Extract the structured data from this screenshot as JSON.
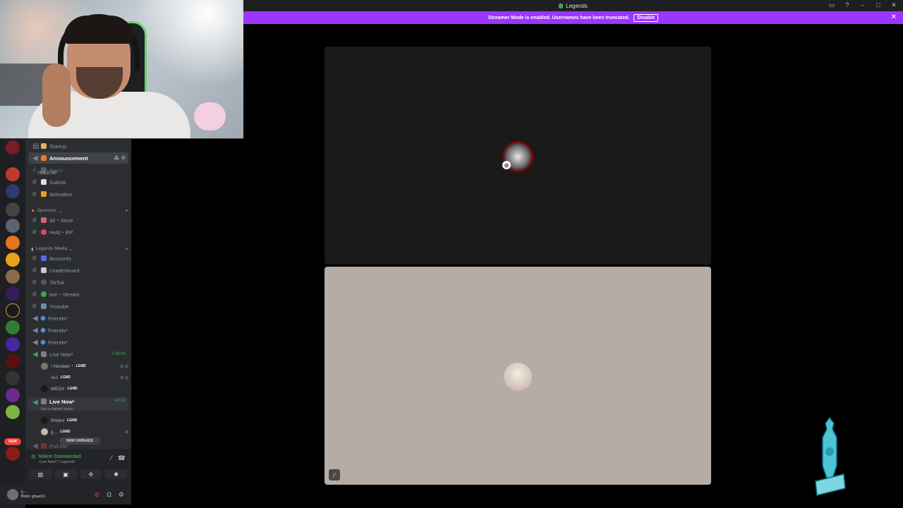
{
  "window": {
    "title": "Legends",
    "controls": [
      "inbox-icon",
      "help-icon",
      "minimize-icon",
      "maximize-icon",
      "close-icon"
    ]
  },
  "banner": {
    "text": "Streamer Mode is enabled. Usernames have been truncated.",
    "disable_label": "Disable",
    "close_symbol": "✕"
  },
  "channels": {
    "startup": "Startup",
    "announcement": "Announcement",
    "boost": "Boost",
    "hold_rp_overlay": "HOLD RP",
    "submit": "Submit",
    "activation": "Activation",
    "sponsors_category": "Sponsors",
    "store": "3II・Store",
    "hold_rp": "Hold・RP",
    "media_category": "Legends Media",
    "accounts": "Accounts",
    "leaderboard": "Leaderboard",
    "tiktok": "TikTok",
    "live_stream": "live・Stream",
    "youtube": "Youtube",
    "friends1": "Friends¹",
    "friends2": "Friends²",
    "friends3": "Friends³",
    "live_now1": "Live Now¹",
    "live_now1_time": "2:46:40",
    "live_now2": "Live Now²",
    "live_now2_time": "40:22",
    "channel_status": "Set a channel status",
    "pull_me": "Pull Me",
    "new_unreads": "NEW UNREADS"
  },
  "voice_users_1": [
    {
      "name": "! Akodaer ⁷",
      "tag": "LGND"
    },
    {
      "name": "ALI",
      "tag": "LGND"
    },
    {
      "name": "WEDX",
      "tag": "LGND"
    }
  ],
  "voice_users_2": [
    {
      "name": "!Pedro",
      "tag": "LGND"
    },
    {
      "name": "ع...",
      "tag": "LGND"
    }
  ],
  "voice_panel": {
    "status": "Voice Connected",
    "location": "Live Now² / Legends"
  },
  "user_panel": {
    "name": "ع...",
    "status": "Brick: ghazi11"
  },
  "server_rail": {
    "new_badge": "NEW"
  },
  "colors": {
    "banner": "#9a36ff",
    "voice_connected": "#3ba55c",
    "muted": "#f23f42",
    "tile_dark": "#1a1a1a",
    "tile_light": "#b5aca6"
  }
}
